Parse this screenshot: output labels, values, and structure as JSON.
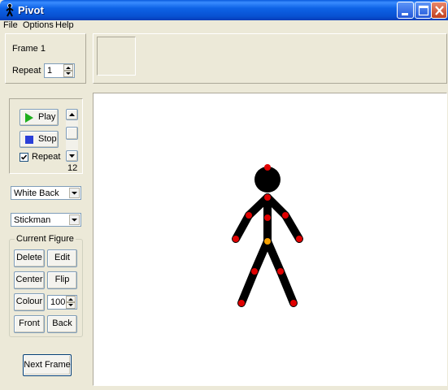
{
  "window": {
    "title": "Pivot"
  },
  "menu": [
    "File",
    "Options",
    "Help"
  ],
  "frame_panel": {
    "frame_label": "Frame 1",
    "repeat_label": "Repeat :",
    "repeat_value": "1"
  },
  "playback": {
    "play_label": "Play",
    "stop_label": "Stop",
    "repeat_label": "Repeat",
    "repeat_checked": true,
    "speed_value": "12"
  },
  "background_select": {
    "value": "White Back"
  },
  "figure_type_select": {
    "value": "Stickman"
  },
  "current_figure": {
    "group_label": "Current Figure",
    "delete_label": "Delete",
    "edit_label": "Edit",
    "center_label": "Center",
    "flip_label": "Flip",
    "colour_label": "Colour",
    "colour_value": "100",
    "front_label": "Front",
    "back_label": "Back"
  },
  "next_frame_label": "Next Frame",
  "colors": {
    "handle": "#E00000",
    "origin_handle": "#F5A000",
    "figure": "#000000",
    "title_bar": "#0A5BDE"
  }
}
